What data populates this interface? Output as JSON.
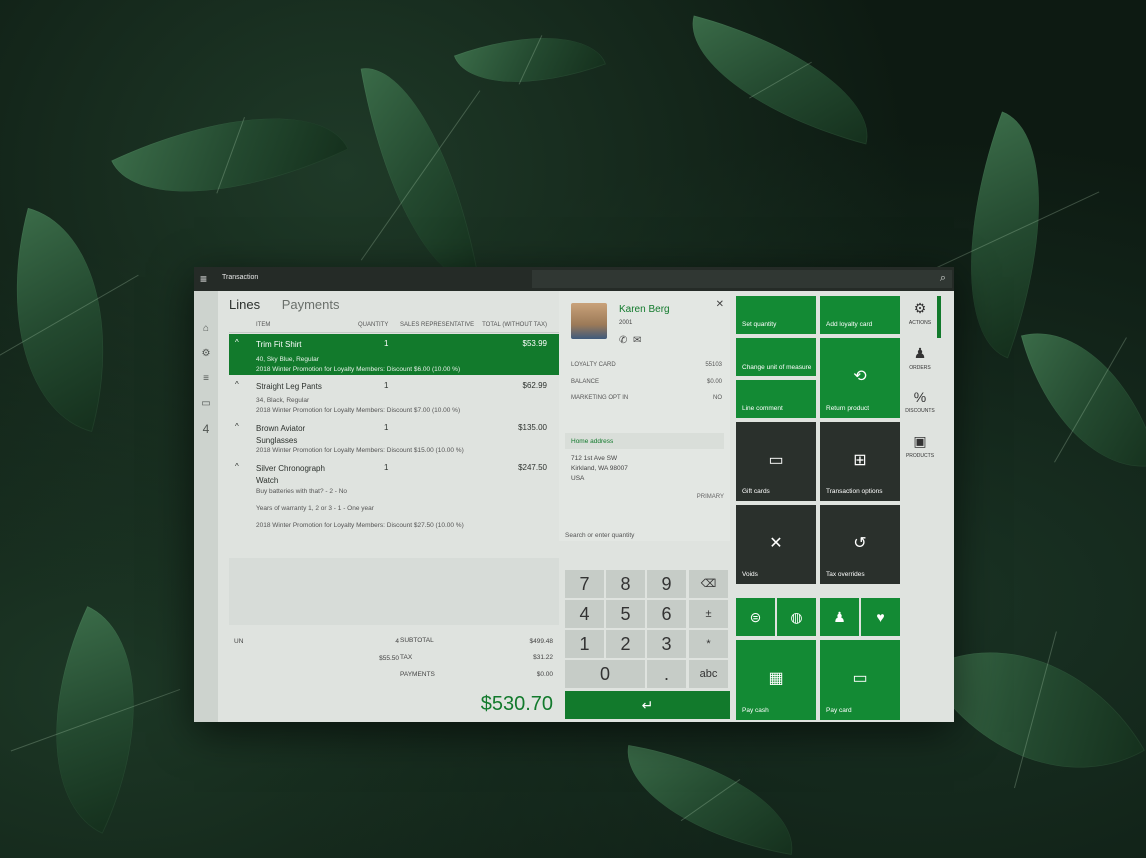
{
  "titlebar": {
    "title": "Transaction"
  },
  "rail": {
    "count": "4"
  },
  "tabs": {
    "lines": "Lines",
    "payments": "Payments"
  },
  "grid": {
    "headers": {
      "item": "ITEM",
      "quantity": "QUANTITY",
      "sales_rep": "SALES REPRESENTATIVE",
      "total": "TOTAL (WITHOUT TAX)"
    },
    "lines": [
      {
        "name": "Trim Fit Shirt",
        "qty": "1",
        "total": "$53.99",
        "detail": "40, Sky Blue, Regular",
        "promo": "2018 Winter Promotion for Loyalty Members: Discount $6.00 (10.00 %)"
      },
      {
        "name": "Straight Leg Pants",
        "qty": "1",
        "total": "$62.99",
        "detail": "34, Black, Regular",
        "promo": "2018 Winter Promotion for Loyalty Members: Discount $7.00 (10.00 %)"
      },
      {
        "name": "Brown Aviator Sunglasses",
        "qty": "1",
        "total": "$135.00",
        "promo": "2018 Winter Promotion for Loyalty Members: Discount $15.00 (10.00 %)"
      },
      {
        "name": "Silver Chronograph Watch",
        "qty": "1",
        "total": "$247.50",
        "detail": "Buy batteries with that? - 2 - No",
        "detail2": "Years of warranty 1, 2 or 3 - 1 - One year",
        "promo": "2018 Winter Promotion for Loyalty Members: Discount $27.50 (10.00 %)"
      }
    ]
  },
  "totals": {
    "lines_label": "UN",
    "lines_value": "4",
    "discounts_value": "$55.50",
    "subtotal_label": "SUBTOTAL",
    "subtotal": "$499.48",
    "tax_label": "TAX",
    "tax": "$31.22",
    "payments_label": "PAYMENTS",
    "payments": "$0.00",
    "amount_due": "$530.70"
  },
  "customer": {
    "name": "Karen Berg",
    "id": "2001",
    "loyalty_card_label": "LOYALTY CARD",
    "loyalty_card": "55103",
    "balance_label": "BALANCE",
    "balance": "$0.00",
    "marketing_label": "MARKETING OPT IN",
    "marketing": "NO",
    "home_address_label": "Home address",
    "address_line1": "712 1st Ave SW",
    "address_line2": "Kirkland, WA 98007",
    "address_line3": "USA",
    "address_type": "PRIMARY"
  },
  "search": {
    "placeholder": "Search or enter quantity"
  },
  "keypad": {
    "k7": "7",
    "k8": "8",
    "k9": "9",
    "backspace": "⌫",
    "k4": "4",
    "k5": "5",
    "k6": "6",
    "plusminus": "±",
    "k1": "1",
    "k2": "2",
    "k3": "3",
    "star": "*",
    "k0": "0",
    "dot": ".",
    "abc": "abc",
    "enter": "↵"
  },
  "tiles": {
    "set_quantity": "Set quantity",
    "add_loyalty_card": "Add loyalty card",
    "change_unit": "Change unit of measure",
    "return_product": "Return product",
    "line_comment": "Line comment",
    "gift_cards": "Gift cards",
    "transaction_options": "Transaction options",
    "voids": "Voids",
    "tax_overrides": "Tax overrides",
    "pay_cash": "Pay cash",
    "pay_card": "Pay card"
  },
  "side_nav": {
    "actions": "ACTIONS",
    "orders": "ORDERS",
    "discounts": "DISCOUNTS",
    "products": "PRODUCTS"
  },
  "colors": {
    "accent": "#127a2c",
    "tile_green": "#138a34",
    "tile_dark": "#2a302c"
  }
}
